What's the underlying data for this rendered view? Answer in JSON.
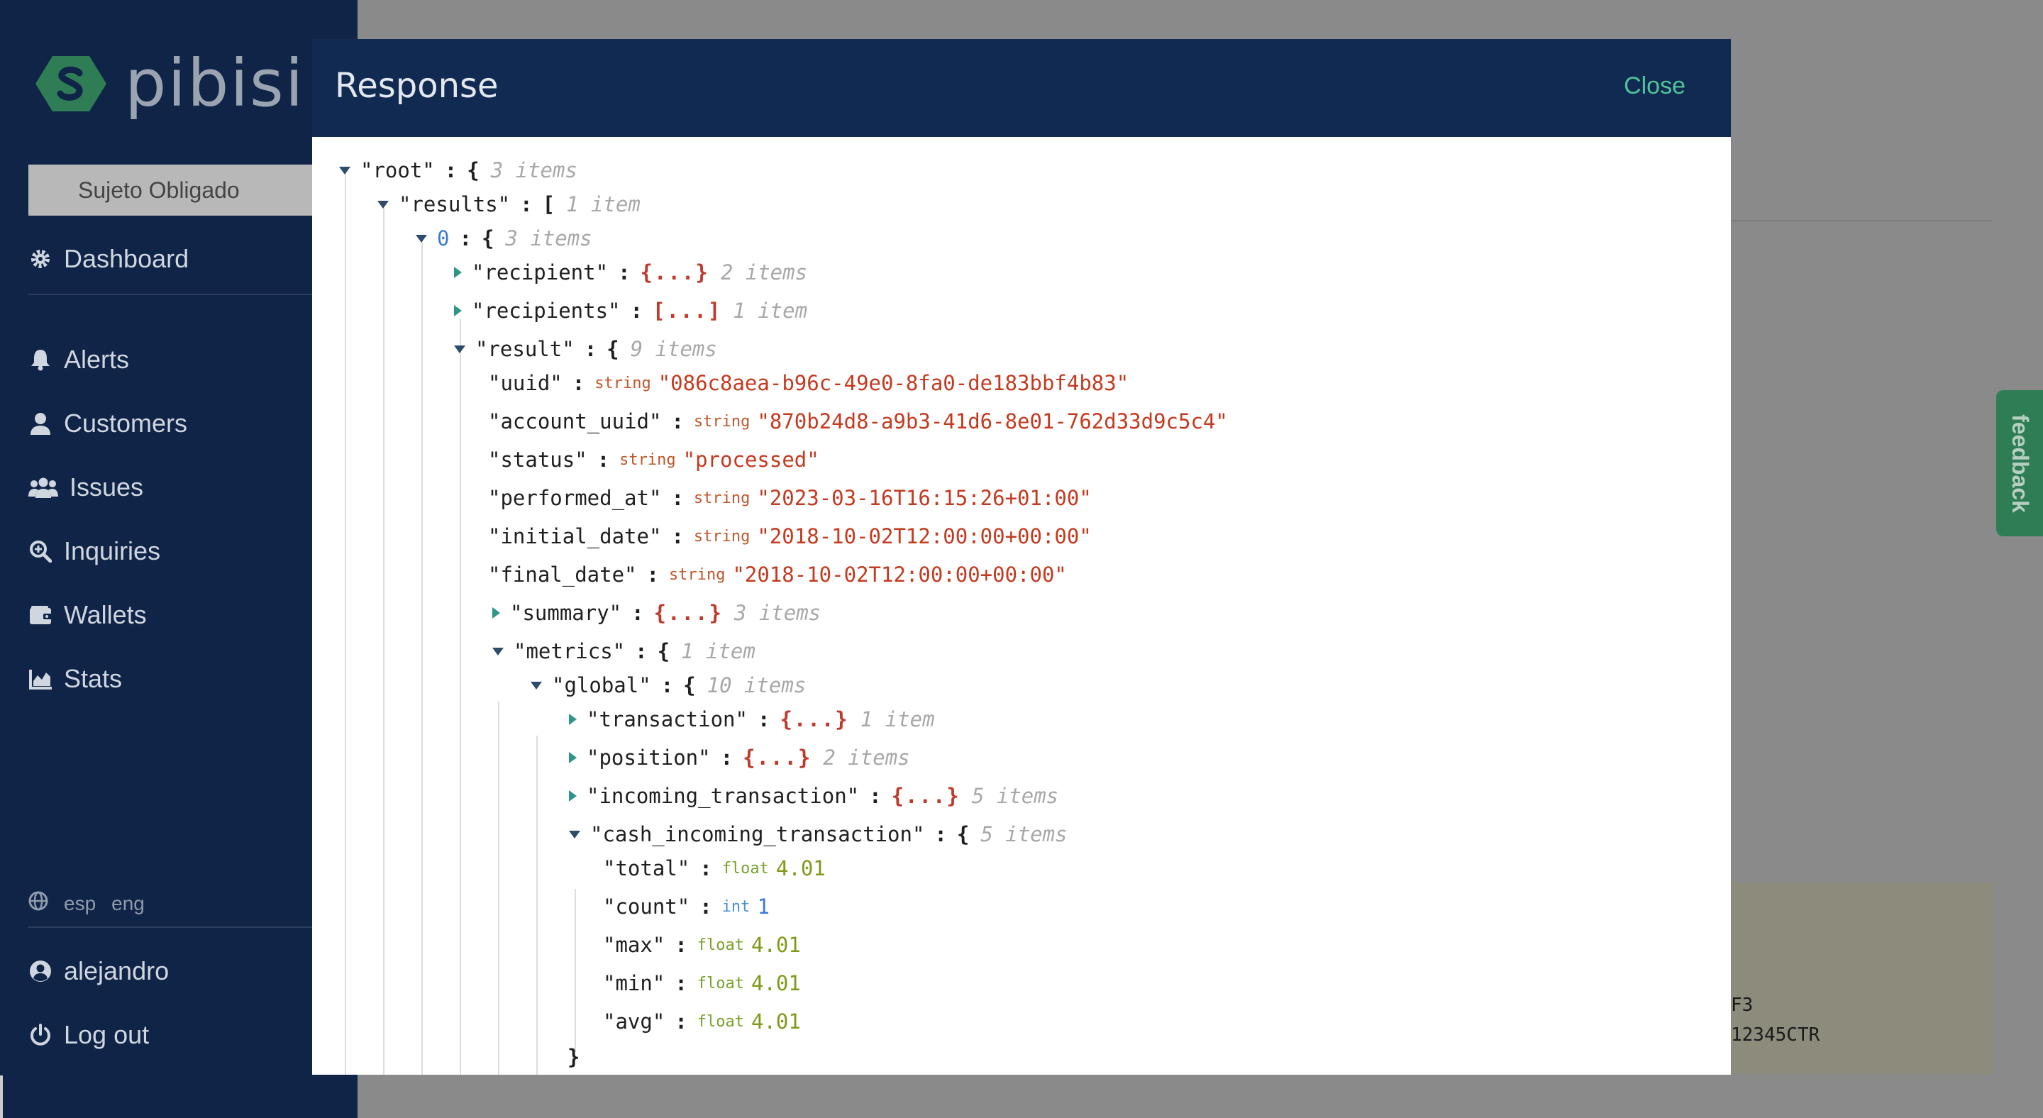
{
  "sidebar": {
    "brand": "pibisi",
    "org_select": "Sujeto Obligado",
    "nav": {
      "dashboard": "Dashboard",
      "alerts": "Alerts",
      "customers": "Customers",
      "issues": "Issues",
      "inquiries": "Inquiries",
      "wallets": "Wallets",
      "stats": "Stats"
    },
    "lang": {
      "esp": "esp",
      "eng": "eng"
    },
    "user": "alejandro",
    "logout": "Log out"
  },
  "background": {
    "text_line_1": "F3",
    "text_line_2": "12345CTR",
    "feedback": "feedback"
  },
  "modal": {
    "title": "Response",
    "close": "Close"
  },
  "tree": {
    "root": {
      "key": "\"root\"",
      "open": "{",
      "count": "3 items"
    },
    "results": {
      "key": "\"results\"",
      "open": "[",
      "count": "1 item"
    },
    "item0": {
      "key": "0",
      "open": "{",
      "count": "3 items"
    },
    "recipient": {
      "key": "\"recipient\"",
      "collapsed": "{...}",
      "count": "2 items"
    },
    "recipients": {
      "key": "\"recipients\"",
      "collapsed": "[...]",
      "count": "1 item"
    },
    "result": {
      "key": "\"result\"",
      "open": "{",
      "count": "9 items"
    },
    "uuid": {
      "key": "\"uuid\"",
      "type": "string",
      "value": "\"086c8aea-b96c-49e0-8fa0-de183bbf4b83\""
    },
    "account_uuid": {
      "key": "\"account_uuid\"",
      "type": "string",
      "value": "\"870b24d8-a9b3-41d6-8e01-762d33d9c5c4\""
    },
    "status": {
      "key": "\"status\"",
      "type": "string",
      "value": "\"processed\""
    },
    "performed_at": {
      "key": "\"performed_at\"",
      "type": "string",
      "value": "\"2023-03-16T16:15:26+01:00\""
    },
    "initial_date": {
      "key": "\"initial_date\"",
      "type": "string",
      "value": "\"2018-10-02T12:00:00+00:00\""
    },
    "final_date": {
      "key": "\"final_date\"",
      "type": "string",
      "value": "\"2018-10-02T12:00:00+00:00\""
    },
    "summary": {
      "key": "\"summary\"",
      "collapsed": "{...}",
      "count": "3 items"
    },
    "metrics": {
      "key": "\"metrics\"",
      "open": "{",
      "count": "1 item"
    },
    "global": {
      "key": "\"global\"",
      "open": "{",
      "count": "10 items"
    },
    "transaction": {
      "key": "\"transaction\"",
      "collapsed": "{...}",
      "count": "1 item"
    },
    "position": {
      "key": "\"position\"",
      "collapsed": "{...}",
      "count": "2 items"
    },
    "incoming_transaction": {
      "key": "\"incoming_transaction\"",
      "collapsed": "{...}",
      "count": "5 items"
    },
    "cash_incoming_transaction": {
      "key": "\"cash_incoming_transaction\"",
      "open": "{",
      "count": "5 items"
    },
    "total": {
      "key": "\"total\"",
      "type": "float",
      "value": "4.01"
    },
    "count_field": {
      "key": "\"count\"",
      "type": "int",
      "value": "1"
    },
    "max": {
      "key": "\"max\"",
      "type": "float",
      "value": "4.01"
    },
    "min": {
      "key": "\"min\"",
      "type": "float",
      "value": "4.01"
    },
    "avg": {
      "key": "\"avg\"",
      "type": "float",
      "value": "4.01"
    },
    "close_brace": "}"
  },
  "colors": {
    "sidebar_bg": "#0f2447",
    "modal_header_bg": "#112a52",
    "close_accent": "#4fc49a",
    "string_value": "#c5391f",
    "float_value": "#7f9a18",
    "int_value": "#3a7bd5",
    "collapsed_toggle": "#2e9688"
  }
}
